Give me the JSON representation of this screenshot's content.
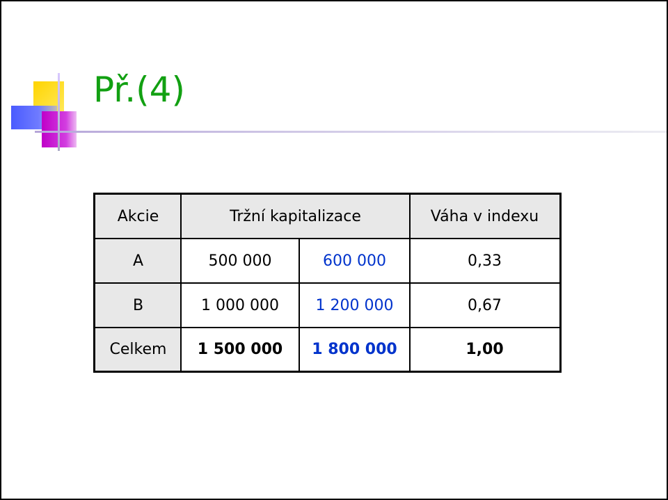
{
  "slide": {
    "title": "Př.(4)"
  },
  "table": {
    "headers": [
      "Akcie",
      "Tržní kapitalizace",
      "Váha v indexu"
    ],
    "rows": [
      {
        "label": "A",
        "cap1": "500 000",
        "cap2": "600 000",
        "weight": "0,33"
      },
      {
        "label": "B",
        "cap1": "1 000 000",
        "cap2": "1 200 000",
        "weight": "0,67"
      },
      {
        "label": "Celkem",
        "cap1": "1 500 000",
        "cap2": "1 800 000",
        "weight": "1,00"
      }
    ]
  },
  "colors": {
    "title": "#12a012",
    "highlight_values": "#0033cc",
    "header_bg": "#e8e8e8"
  }
}
